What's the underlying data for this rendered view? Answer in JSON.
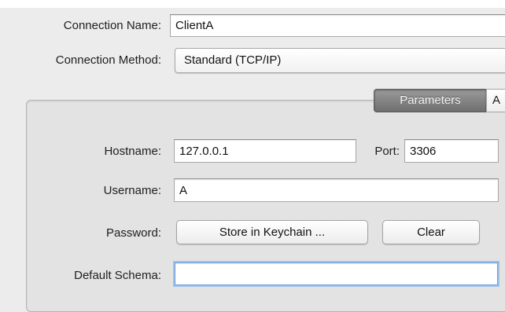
{
  "connection": {
    "name_label": "Connection Name:",
    "name_value": "ClientA",
    "method_label": "Connection Method:",
    "method_value": "Standard (TCP/IP)"
  },
  "tabs": [
    {
      "label": "Parameters",
      "active": true
    },
    {
      "label": "A",
      "active": false
    }
  ],
  "parameters": {
    "hostname_label": "Hostname:",
    "hostname_value": "127.0.0.1",
    "port_label": "Port:",
    "port_value": "3306",
    "username_label": "Username:",
    "username_value": "A",
    "password_label": "Password:",
    "store_keychain_label": "Store in Keychain ...",
    "clear_label": "Clear",
    "schema_label": "Default Schema:",
    "schema_value": ""
  },
  "colors": {
    "window_bg": "#ececec",
    "panel_bg": "#e3e3e3",
    "active_tab": "#7f7f7f",
    "focus_ring": "#9ec1ee"
  }
}
